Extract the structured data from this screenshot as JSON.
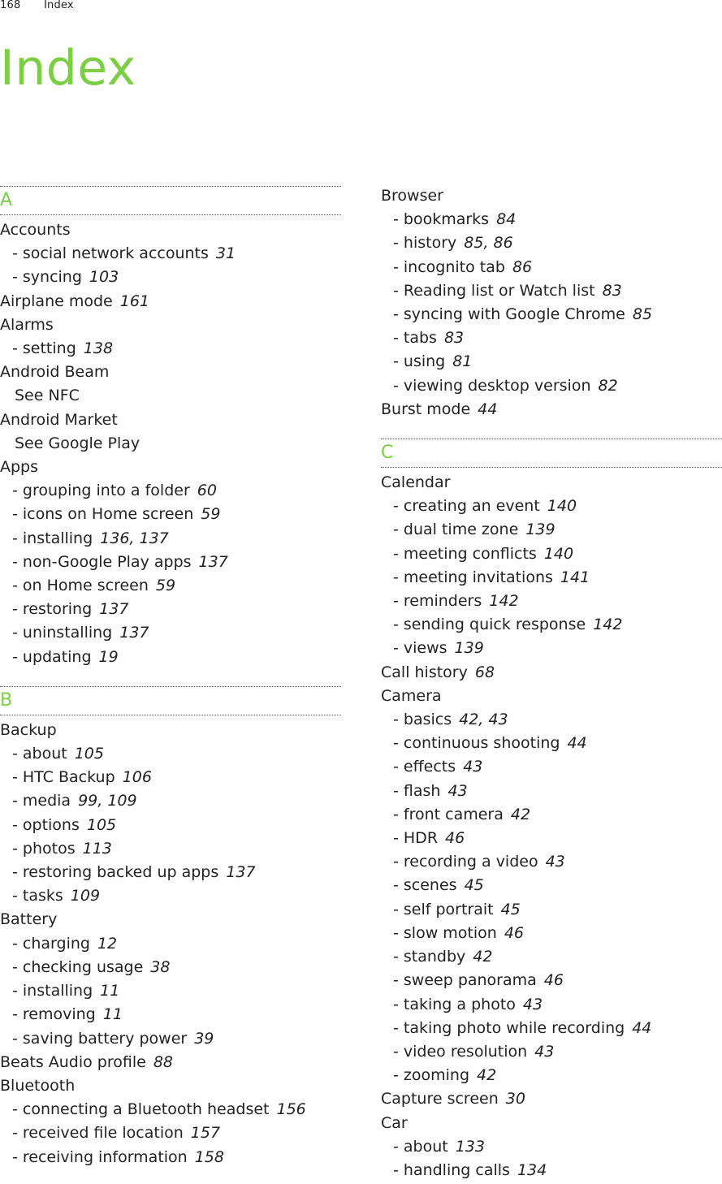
{
  "header": {
    "page_number": "168",
    "section": "Index"
  },
  "title": "Index",
  "left_column": [
    {
      "type": "letter",
      "text": "A"
    },
    {
      "type": "main",
      "text": "Accounts"
    },
    {
      "type": "sub",
      "text": "- social network accounts",
      "pages": "31"
    },
    {
      "type": "sub",
      "text": "- syncing",
      "pages": "103"
    },
    {
      "type": "main",
      "text": "Airplane mode",
      "pages": "161"
    },
    {
      "type": "main",
      "text": "Alarms"
    },
    {
      "type": "sub",
      "text": "- setting",
      "pages": "138"
    },
    {
      "type": "main",
      "text": "Android Beam"
    },
    {
      "type": "see",
      "text": "See NFC"
    },
    {
      "type": "main",
      "text": "Android Market"
    },
    {
      "type": "see",
      "text": "See Google Play"
    },
    {
      "type": "main",
      "text": "Apps"
    },
    {
      "type": "sub",
      "text": "- grouping into a folder",
      "pages": "60"
    },
    {
      "type": "sub",
      "text": "- icons on Home screen",
      "pages": "59"
    },
    {
      "type": "sub",
      "text": "- installing",
      "pages": "136, 137"
    },
    {
      "type": "sub",
      "text": "- non-Google Play apps",
      "pages": "137"
    },
    {
      "type": "sub",
      "text": "- on Home screen",
      "pages": "59"
    },
    {
      "type": "sub",
      "text": "- restoring",
      "pages": "137"
    },
    {
      "type": "sub",
      "text": "- uninstalling",
      "pages": "137"
    },
    {
      "type": "sub",
      "text": "- updating",
      "pages": "19"
    },
    {
      "type": "letter",
      "text": "B"
    },
    {
      "type": "main",
      "text": "Backup"
    },
    {
      "type": "sub",
      "text": "- about",
      "pages": "105"
    },
    {
      "type": "sub",
      "text": "- HTC Backup",
      "pages": "106"
    },
    {
      "type": "sub",
      "text": "- media",
      "pages": "99, 109"
    },
    {
      "type": "sub",
      "text": "- options",
      "pages": "105"
    },
    {
      "type": "sub",
      "text": "- photos",
      "pages": "113"
    },
    {
      "type": "sub",
      "text": "- restoring backed up apps",
      "pages": "137"
    },
    {
      "type": "sub",
      "text": "- tasks",
      "pages": "109"
    },
    {
      "type": "main",
      "text": "Battery"
    },
    {
      "type": "sub",
      "text": "- charging",
      "pages": "12"
    },
    {
      "type": "sub",
      "text": "- checking usage",
      "pages": "38"
    },
    {
      "type": "sub",
      "text": "- installing",
      "pages": "11"
    },
    {
      "type": "sub",
      "text": "- removing",
      "pages": "11"
    },
    {
      "type": "sub",
      "text": "- saving battery power",
      "pages": "39"
    },
    {
      "type": "main",
      "text": "Beats Audio profile",
      "pages": "88"
    },
    {
      "type": "main",
      "text": "Bluetooth"
    },
    {
      "type": "sub",
      "text": "- connecting a Bluetooth headset",
      "pages": "156"
    },
    {
      "type": "sub",
      "text": "- received file location",
      "pages": "157"
    },
    {
      "type": "sub",
      "text": "- receiving information",
      "pages": "158"
    }
  ],
  "right_column": [
    {
      "type": "main",
      "text": "Browser"
    },
    {
      "type": "sub",
      "text": "- bookmarks",
      "pages": "84"
    },
    {
      "type": "sub",
      "text": "- history",
      "pages": "85, 86"
    },
    {
      "type": "sub",
      "text": "- incognito tab",
      "pages": "86"
    },
    {
      "type": "sub",
      "text": "- Reading list or Watch list",
      "pages": "83"
    },
    {
      "type": "sub",
      "text": "- syncing with Google Chrome",
      "pages": "85"
    },
    {
      "type": "sub",
      "text": "- tabs",
      "pages": "83"
    },
    {
      "type": "sub",
      "text": "- using",
      "pages": "81"
    },
    {
      "type": "sub",
      "text": "- viewing desktop version",
      "pages": "82"
    },
    {
      "type": "main",
      "text": "Burst mode",
      "pages": "44"
    },
    {
      "type": "letter",
      "text": "C"
    },
    {
      "type": "main",
      "text": "Calendar"
    },
    {
      "type": "sub",
      "text": "- creating an event",
      "pages": "140"
    },
    {
      "type": "sub",
      "text": "- dual time zone",
      "pages": "139"
    },
    {
      "type": "sub",
      "text": "- meeting conflicts",
      "pages": "140"
    },
    {
      "type": "sub",
      "text": "- meeting invitations",
      "pages": "141"
    },
    {
      "type": "sub",
      "text": "- reminders",
      "pages": "142"
    },
    {
      "type": "sub",
      "text": "- sending quick response",
      "pages": "142"
    },
    {
      "type": "sub",
      "text": "- views",
      "pages": "139"
    },
    {
      "type": "main",
      "text": "Call history",
      "pages": "68"
    },
    {
      "type": "main",
      "text": "Camera"
    },
    {
      "type": "sub",
      "text": "- basics",
      "pages": "42, 43"
    },
    {
      "type": "sub",
      "text": "- continuous shooting",
      "pages": "44"
    },
    {
      "type": "sub",
      "text": "- effects",
      "pages": "43"
    },
    {
      "type": "sub",
      "text": "- flash",
      "pages": "43"
    },
    {
      "type": "sub",
      "text": "- front camera",
      "pages": "42"
    },
    {
      "type": "sub",
      "text": "- HDR",
      "pages": "46"
    },
    {
      "type": "sub",
      "text": "- recording a video",
      "pages": "43"
    },
    {
      "type": "sub",
      "text": "- scenes",
      "pages": "45"
    },
    {
      "type": "sub",
      "text": "- self portrait",
      "pages": "45"
    },
    {
      "type": "sub",
      "text": "- slow motion",
      "pages": "46"
    },
    {
      "type": "sub",
      "text": "- standby",
      "pages": "42"
    },
    {
      "type": "sub",
      "text": "- sweep panorama",
      "pages": "46"
    },
    {
      "type": "sub",
      "text": "- taking a photo",
      "pages": "43"
    },
    {
      "type": "sub",
      "text": "- taking photo while recording",
      "pages": "44"
    },
    {
      "type": "sub",
      "text": "- video resolution",
      "pages": "43"
    },
    {
      "type": "sub",
      "text": "- zooming",
      "pages": "42"
    },
    {
      "type": "main",
      "text": "Capture screen",
      "pages": "30"
    },
    {
      "type": "main",
      "text": "Car"
    },
    {
      "type": "sub",
      "text": "- about",
      "pages": "133"
    },
    {
      "type": "sub",
      "text": "- handling calls",
      "pages": "134"
    }
  ],
  "colors": {
    "accent": "#7ccf44",
    "text": "#222222",
    "rule": "#555555"
  }
}
